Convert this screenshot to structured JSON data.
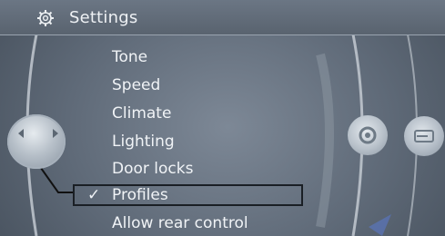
{
  "header": {
    "title": "Settings",
    "icon": "gear-icon"
  },
  "menu": {
    "items": [
      {
        "label": "Tone"
      },
      {
        "label": "Speed"
      },
      {
        "label": "Climate"
      },
      {
        "label": "Lighting"
      },
      {
        "label": "Door locks"
      },
      {
        "label": "Profiles",
        "checked": true
      },
      {
        "label": "Allow rear control"
      }
    ],
    "check_mark": "✓"
  },
  "controls": {
    "left_knob_icon": "left-right-arrows-icon",
    "right_knob_1_icon": "gear-icon",
    "right_knob_2_icon": "card-icon"
  },
  "colors": {
    "background": "#5f6a78",
    "text": "#f0f3f6",
    "selection_border": "#1a1f25"
  }
}
